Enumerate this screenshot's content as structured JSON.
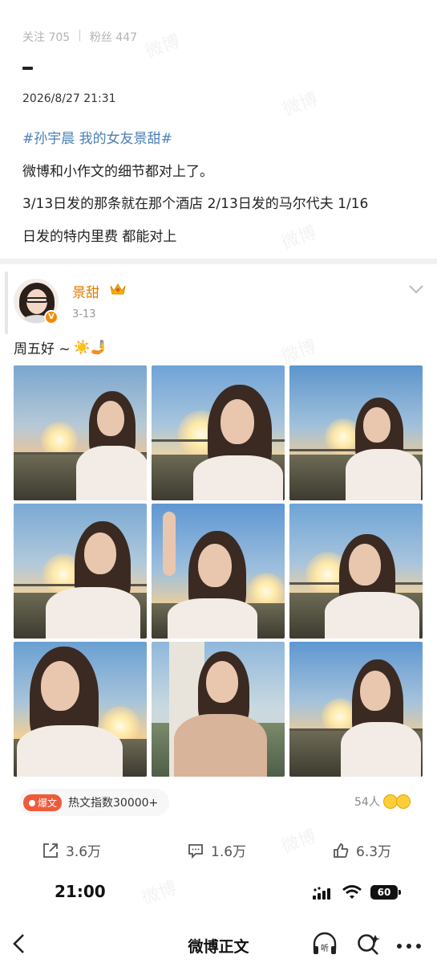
{
  "profile_stats": {
    "following": "关注 705",
    "separator": "|",
    "followers": "粉丝 447"
  },
  "post": {
    "time": "2026/8/27 21:31",
    "hashtag": "#孙宇晨 我的女友景甜#",
    "lines": [
      "微博和小作文的细节都对上了。",
      "3/13日发的那条就在那个酒店 2/13日发的马尔代夫 1/16",
      "日发的特内里费 都能对上"
    ]
  },
  "repost": {
    "author": "景甜",
    "date": "3-13",
    "text": "周五好 ~",
    "emojis": "☀️🤳"
  },
  "hot": {
    "tag": "爆文",
    "label": "热文指数30000+"
  },
  "likers": {
    "count": "54人"
  },
  "actions": {
    "repost": "3.6万",
    "comment": "1.6万",
    "like": "6.3万"
  },
  "status_bar": {
    "time": "21:00",
    "battery": "60"
  },
  "nav": {
    "title": "微博正文"
  },
  "watermark": "微博",
  "colors": {
    "hashtag": "#4a7fb5",
    "author": "#e67c00",
    "hot_tag": "#ef5b3a"
  },
  "icons": [
    "crown-icon",
    "chevron-down-icon",
    "repost-icon",
    "comment-icon",
    "like-icon",
    "signal-icon",
    "wifi-icon",
    "back-icon",
    "listen-icon",
    "search-icon",
    "more-icon"
  ]
}
